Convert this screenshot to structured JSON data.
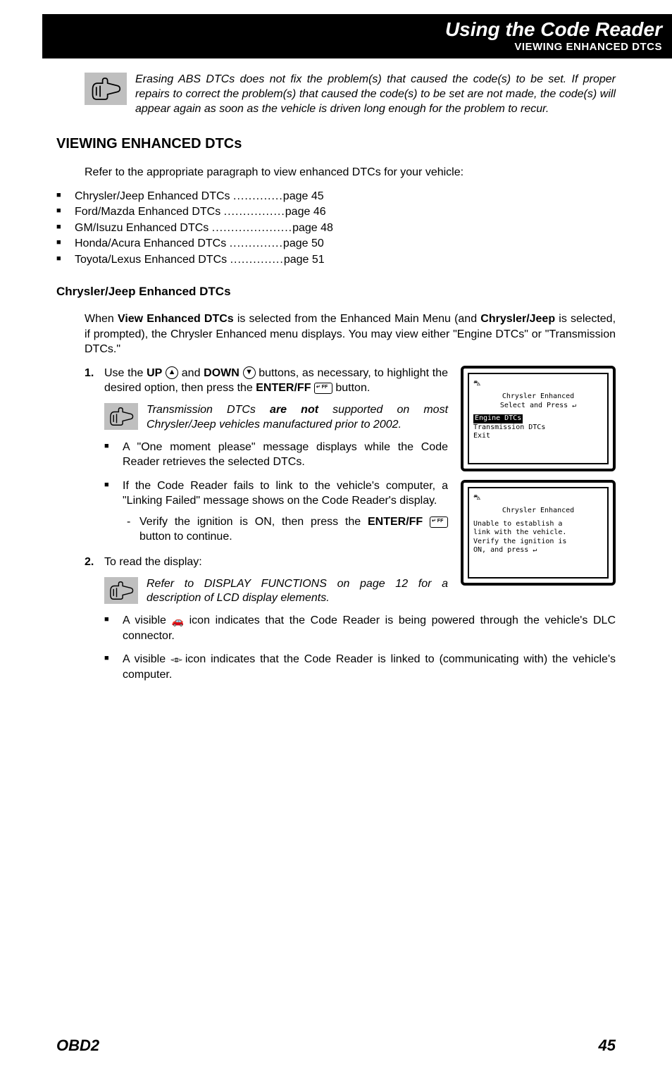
{
  "header": {
    "title": "Using the Code Reader",
    "subtitle": "VIEWING ENHANCED DTCS"
  },
  "topNote": "Erasing ABS DTCs does not fix the problem(s) that caused the code(s) to be set. If proper repairs to correct the problem(s) that caused the code(s) to be set are not made, the code(s) will appear again as soon as the vehicle is driven long enough for the problem to recur.",
  "sectionTitle": "VIEWING ENHANCED DTCs",
  "intro": "Refer to the appropriate paragraph to view enhanced DTCs for your vehicle:",
  "vehicleList": [
    {
      "name": "Chrysler/Jeep Enhanced DTCs",
      "page": "page 45"
    },
    {
      "name": "Ford/Mazda Enhanced DTCs",
      "page": "page 46"
    },
    {
      "name": "GM/Isuzu Enhanced DTCs",
      "page": "page 48"
    },
    {
      "name": "Honda/Acura Enhanced DTCs",
      "page": "page 50"
    },
    {
      "name": "Toyota/Lexus Enhanced DTCs",
      "page": "page 51"
    }
  ],
  "subTitle": "Chrysler/Jeep Enhanced DTCs",
  "subIntroParts": {
    "p1": "When ",
    "b1": "View Enhanced DTCs",
    "p2": " is selected from the Enhanced Main Menu (and ",
    "b2": "Chrysler/Jeep",
    "p3": " is selected, if prompted), the Chrysler Enhanced menu displays. You may view either \"Engine DTCs\" or \"Transmission DTCs.\""
  },
  "step1Parts": {
    "p1": "Use the ",
    "b1": "UP",
    "p2": " and ",
    "b2": "DOWN",
    "p3": " buttons, as necessary, to highlight the desired option, then press the ",
    "b3": "ENTER/FF",
    "p4": " button."
  },
  "step1NoteParts": {
    "p1": "Transmission DTCs ",
    "b1": "are not",
    "p2": " supported on most Chrysler/Jeep vehicles manufactured prior to 2002."
  },
  "step1b1": "A \"One moment please\" message displays while the Code Reader retrieves the selected DTCs.",
  "step1b2": "If the Code Reader fails to link to the vehicle's computer, a \"Linking Failed\" message shows on the Code Reader's display.",
  "step1dashParts": {
    "p1": "Verify the ignition is ON, then press the ",
    "b1": "ENTER/FF",
    "p2": " button to continue."
  },
  "step2": "To read the display:",
  "step2Note": "Refer to DISPLAY FUNCTIONS on page 12 for a description of LCD display elements.",
  "step2b1a": "A visible ",
  "step2b1b": " icon indicates that the Code Reader is being powered through the vehicle's DLC connector.",
  "step2b2a": "A visible ",
  "step2b2b": " icon indicates that the Code Reader is linked to (communicating with) the vehicle's computer.",
  "screen1": {
    "title": "Chrysler Enhanced",
    "sub": "Select and Press ↵",
    "hl": "Engine DTCs",
    "l1": "Transmission DTCs",
    "l2": "Exit"
  },
  "screen2": {
    "title": "Chrysler Enhanced",
    "l1": "Unable to establish a",
    "l2": "link with the vehicle.",
    "l3": "Verify the ignition is",
    "l4": "ON, and press ↵"
  },
  "footer": {
    "left": "OBD2",
    "right": "45"
  }
}
